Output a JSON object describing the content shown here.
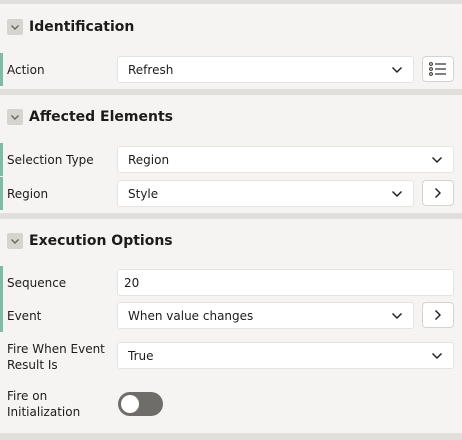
{
  "sections": {
    "identification": {
      "title": "Identification"
    },
    "affected": {
      "title": "Affected Elements"
    },
    "execution": {
      "title": "Execution Options"
    }
  },
  "fields": {
    "action": {
      "label": "Action",
      "value": "Refresh"
    },
    "selection_type": {
      "label": "Selection Type",
      "value": "Region"
    },
    "region": {
      "label": "Region",
      "value": "Style"
    },
    "sequence": {
      "label": "Sequence",
      "value": "20"
    },
    "event": {
      "label": "Event",
      "value": "When value changes"
    },
    "fire_when_line1": "Fire When Event",
    "fire_when_line2": "Result Is",
    "fire_when_value": "True",
    "fire_init_line1": "Fire on",
    "fire_init_line2": "Initialization",
    "fire_init_state": "off"
  },
  "icons": {
    "section_toggle": "chevron-down-icon",
    "select": "chevron-down-icon",
    "list_button": "list-icon",
    "goto_button": "chevron-right-icon"
  },
  "colors": {
    "required_bar": "#86b8a4",
    "toggle_off": "#6f6d6a"
  }
}
